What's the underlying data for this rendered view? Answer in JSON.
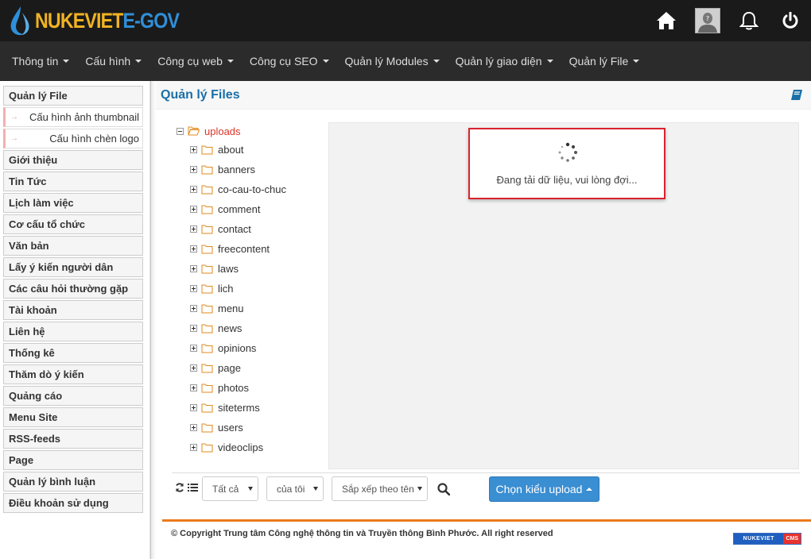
{
  "brand": {
    "part1": "NUKEVIET",
    "part2": "E-GOV",
    "color1": "#f0b323",
    "color2": "#2f8fd8"
  },
  "top_icons": [
    "home-icon",
    "avatar",
    "bell-icon",
    "power-icon"
  ],
  "nav": [
    {
      "label": "Thông tin"
    },
    {
      "label": "Cấu hình"
    },
    {
      "label": "Công cụ web"
    },
    {
      "label": "Công cụ SEO"
    },
    {
      "label": "Quản lý Modules"
    },
    {
      "label": "Quản lý giao diện"
    },
    {
      "label": "Quản lý File"
    }
  ],
  "sidebar": {
    "current": "Quản lý File",
    "subitems": [
      "Cấu hình ảnh thumbnail",
      "Cấu hình chèn logo"
    ],
    "items": [
      "Giới thiệu",
      "Tin Tức",
      "Lịch làm việc",
      "Cơ cấu tổ chức",
      "Văn bản",
      "Lấy ý kiến người dân",
      "Các câu hỏi thường gặp",
      "Tài khoản",
      "Liên hệ",
      "Thống kê",
      "Thăm dò ý kiến",
      "Quảng cáo",
      "Menu Site",
      "RSS-feeds",
      "Page",
      "Quản lý bình luận",
      "Điều khoản sử dụng"
    ]
  },
  "main": {
    "title": "Quản lý Files",
    "tree": {
      "root": "uploads",
      "folders": [
        "about",
        "banners",
        "co-cau-to-chuc",
        "comment",
        "contact",
        "freecontent",
        "laws",
        "lich",
        "menu",
        "news",
        "opinions",
        "page",
        "photos",
        "siteterms",
        "users",
        "videoclips"
      ]
    },
    "loading_text": "Đang tải dữ liệu, vui lòng đợi...",
    "toolbar": {
      "filter_type": "Tất cả",
      "filter_owner": "của tôi",
      "sort": "Sắp xếp theo tên",
      "upload_label": "Chọn kiểu upload"
    }
  },
  "footer": {
    "copyright": "© Copyright Trung tâm Công nghệ thông tin và Truyền thông Bình Phước. All right reserved",
    "logo_part1": "NUKEVIET",
    "logo_part2": "CMS"
  },
  "colors": {
    "accent": "#1a6fa6",
    "highlight": "#d9232e",
    "footer_line": "#ec7a1c",
    "button": "#3a8ed2"
  }
}
